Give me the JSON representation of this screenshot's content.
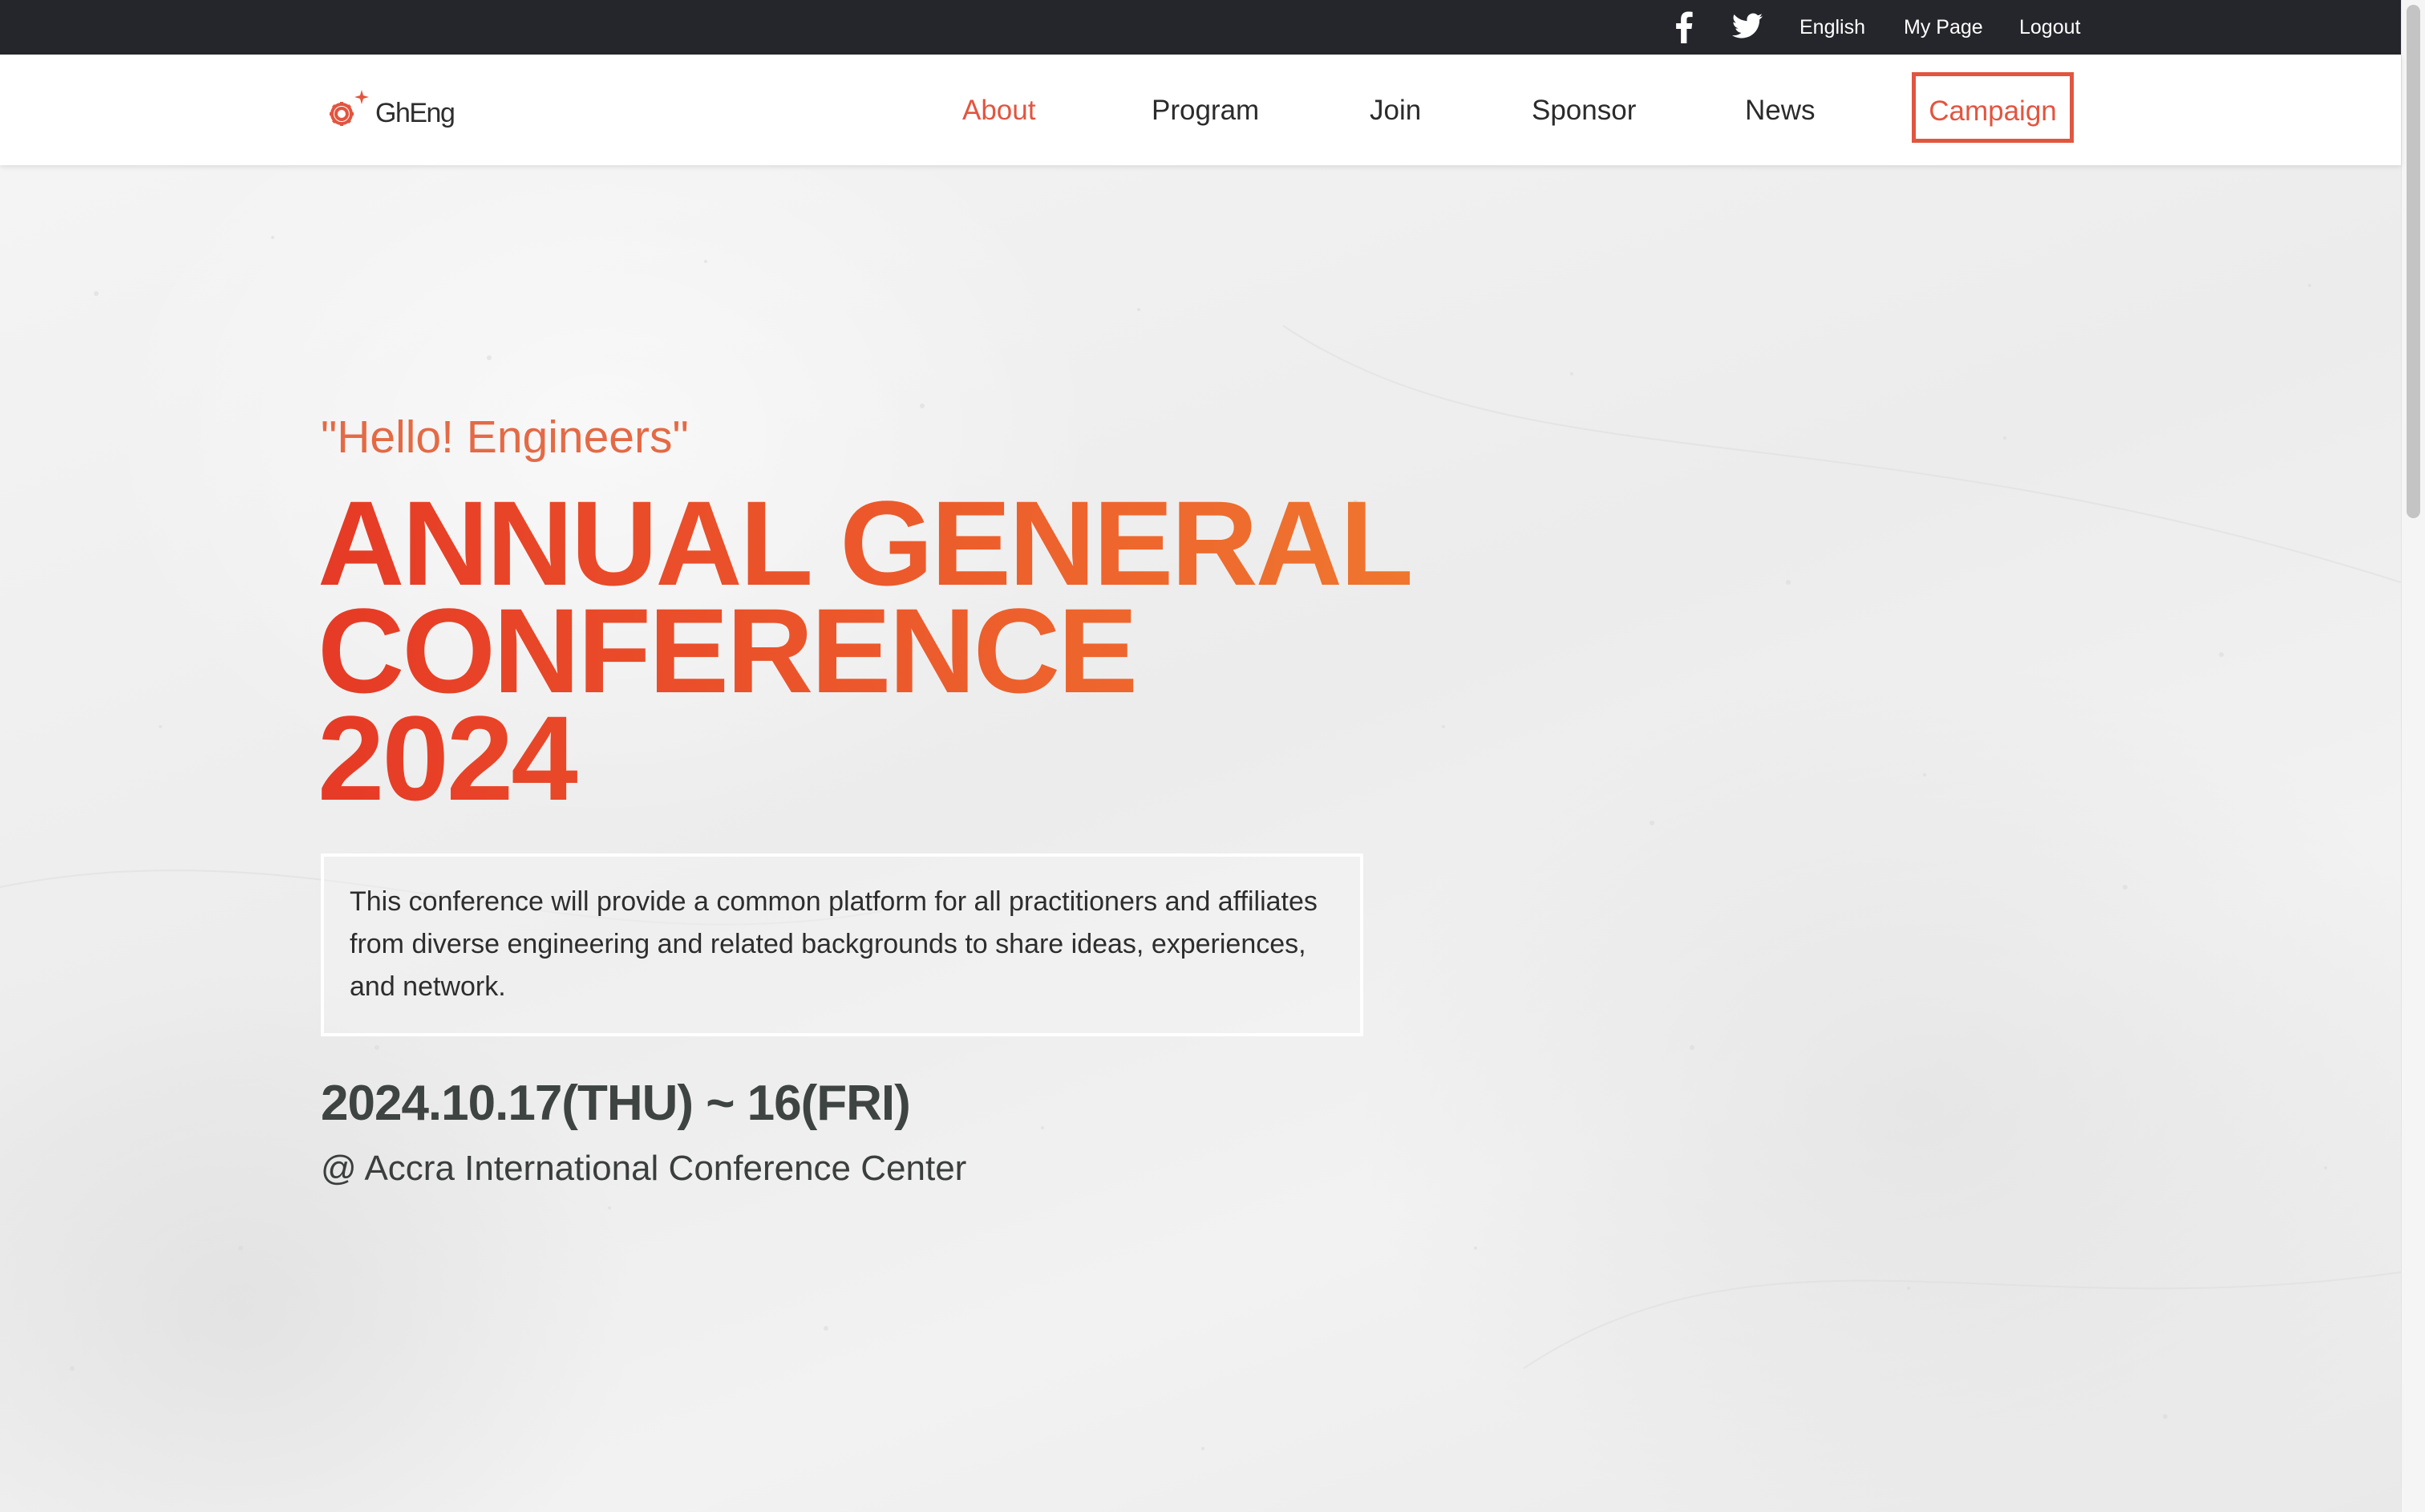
{
  "topbar": {
    "icons": [
      "facebook-icon",
      "twitter-icon"
    ],
    "language": "English",
    "my_page": "My Page",
    "logout": "Logout"
  },
  "brand": {
    "logo_text": "GhEng",
    "accent_color": "#e2553f"
  },
  "nav": {
    "items": [
      {
        "label": "About",
        "active": true
      },
      {
        "label": "Program"
      },
      {
        "label": "Join"
      },
      {
        "label": "Sponsor"
      },
      {
        "label": "News"
      },
      {
        "label": "Campaign",
        "outlined": true
      }
    ]
  },
  "hero": {
    "greeting": "\"Hello! Engineers\"",
    "title_lines": [
      "ANNUAL GENERAL",
      "CONFERENCE",
      "2024"
    ],
    "description": "This conference will provide a common platform for all practitioners and affiliates from diverse engineering and related backgrounds to share ideas, experiences, and network.",
    "dates": "2024.10.17(THU) ~ 16(FRI)",
    "venue": "@ Accra International Conference Center"
  }
}
